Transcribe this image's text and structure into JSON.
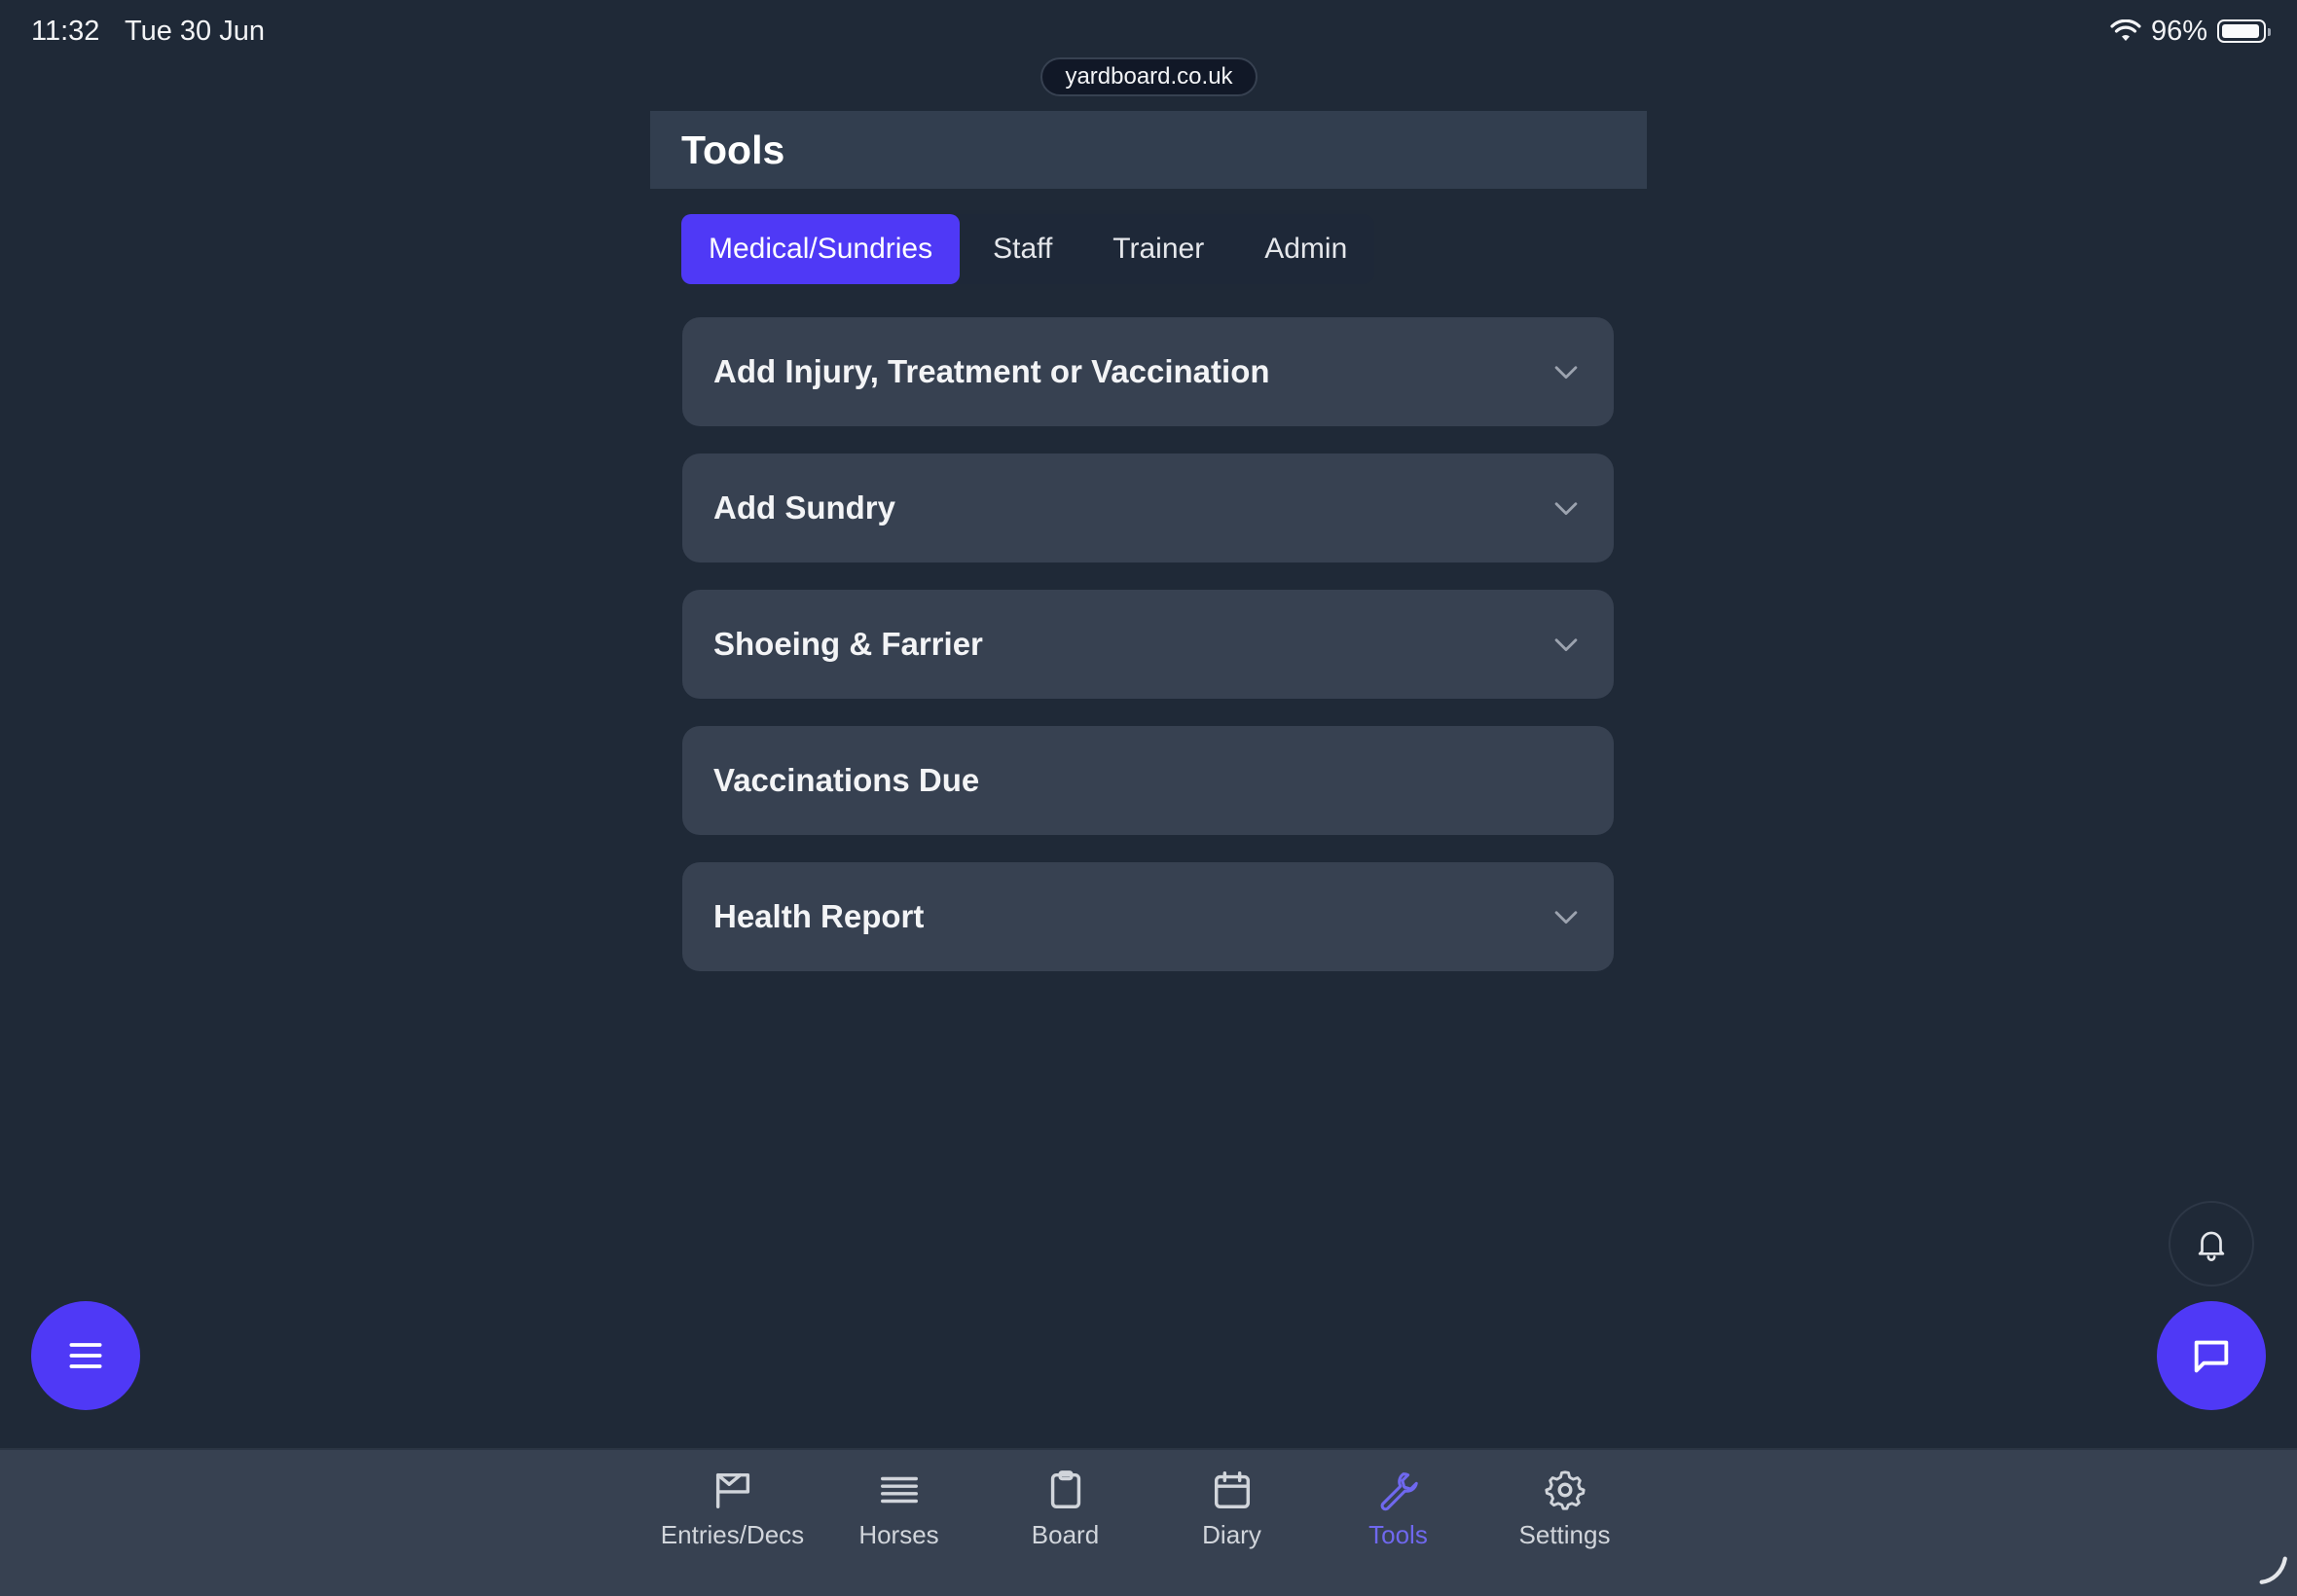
{
  "status_bar": {
    "time": "11:32",
    "date": "Tue 30 Jun",
    "battery": "96%",
    "battery_level": 0.96
  },
  "browser": {
    "url": "yardboard.co.uk"
  },
  "header": {
    "title": "Tools"
  },
  "tabs": [
    {
      "label": "Medical/Sundries",
      "active": true
    },
    {
      "label": "Staff",
      "active": false
    },
    {
      "label": "Trainer",
      "active": false
    },
    {
      "label": "Admin",
      "active": false
    }
  ],
  "cards": [
    {
      "label": "Add Injury, Treatment or Vaccination",
      "expandable": true
    },
    {
      "label": "Add Sundry",
      "expandable": true
    },
    {
      "label": "Shoeing & Farrier",
      "expandable": true
    },
    {
      "label": "Vaccinations Due",
      "expandable": false
    },
    {
      "label": "Health Report",
      "expandable": true
    }
  ],
  "bottom_nav": [
    {
      "label": "Entries/Decs",
      "icon": "flag-icon",
      "active": false
    },
    {
      "label": "Horses",
      "icon": "list-icon",
      "active": false
    },
    {
      "label": "Board",
      "icon": "clipboard-icon",
      "active": false
    },
    {
      "label": "Diary",
      "icon": "calendar-icon",
      "active": false
    },
    {
      "label": "Tools",
      "icon": "wrench-icon",
      "active": true
    },
    {
      "label": "Settings",
      "icon": "gear-icon",
      "active": false
    }
  ],
  "colors": {
    "background": "#1f2937",
    "accent": "#4f39f6",
    "card": "#374151",
    "active_nav": "#6f68ee"
  }
}
